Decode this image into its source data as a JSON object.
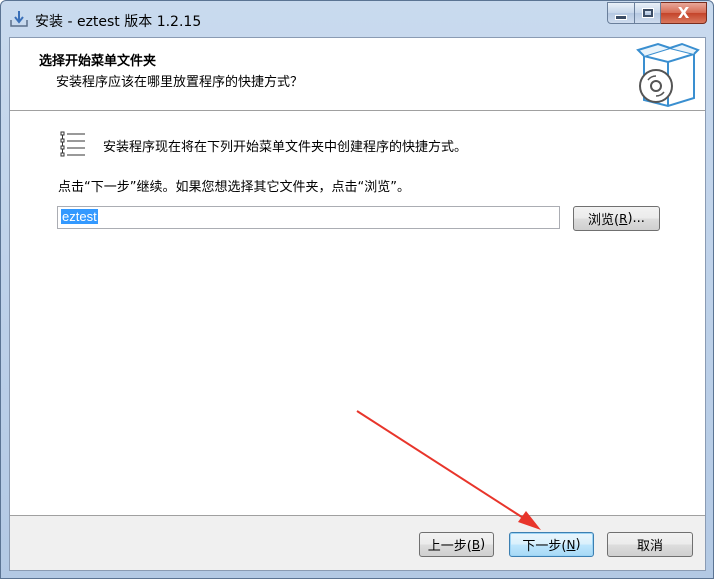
{
  "window": {
    "title": "安装 - eztest 版本 1.2.15",
    "minimize_icon": "minimize-icon",
    "maximize_icon": "maximize-icon",
    "close_icon": "close-icon",
    "close_glyph": "X"
  },
  "header": {
    "title": "选择开始菜单文件夹",
    "subtitle": "安装程序应该在哪里放置程序的快捷方式？",
    "image_icon": "software-box-cd-icon"
  },
  "body": {
    "list_icon": "start-menu-folder-list-icon",
    "description": "安装程序现在将在下列开始菜单文件夹中创建程序的快捷方式。",
    "instruction": "点击“下一步”继续。如果您想选择其它文件夹，点击“浏览”。",
    "folder_value": "eztest",
    "browse_label": "浏览(",
    "browse_accel": "R",
    "browse_suffix": ")..."
  },
  "footer": {
    "back_label": "上一步(",
    "back_accel": "B",
    "back_suffix": ")",
    "next_label": "下一步(",
    "next_accel": "N",
    "next_suffix": ")",
    "cancel_label": "取消"
  },
  "annotation": {
    "arrow_color": "#e8352b",
    "arrow_icon": "red-arrow-annotation"
  }
}
